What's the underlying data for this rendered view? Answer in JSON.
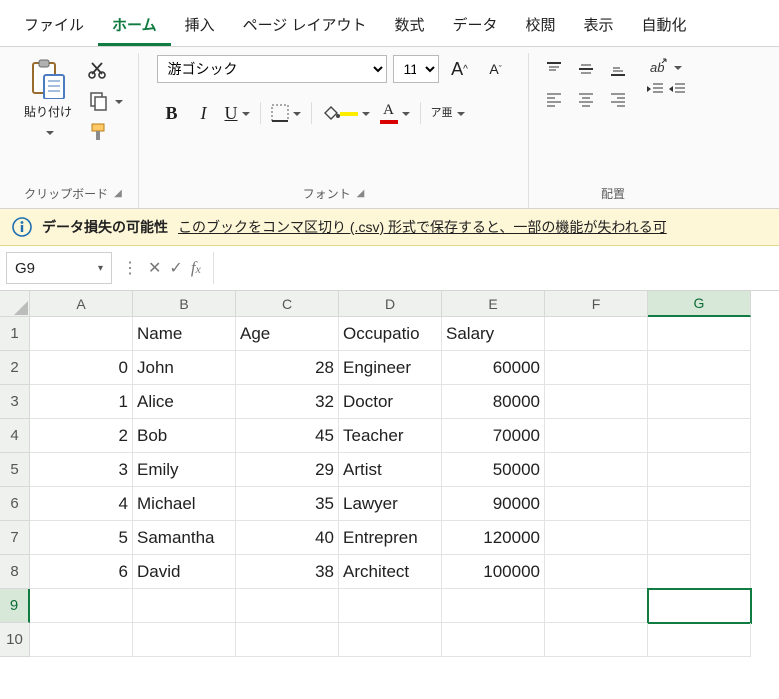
{
  "menu": {
    "items": [
      "ファイル",
      "ホーム",
      "挿入",
      "ページ レイアウト",
      "数式",
      "データ",
      "校閲",
      "表示",
      "自動化"
    ],
    "active_index": 1
  },
  "ribbon": {
    "clipboard": {
      "paste_label": "貼り付け",
      "group_label": "クリップボード"
    },
    "font": {
      "name": "游ゴシック",
      "size": "11",
      "group_label": "フォント",
      "bold": "B",
      "italic": "I",
      "underline": "U",
      "ruby": "ア亜"
    },
    "alignment": {
      "group_label": "配置"
    }
  },
  "warning": {
    "title": "データ損失の可能性",
    "message": "このブックをコンマ区切り (.csv) 形式で保存すると、一部の機能が失われる可"
  },
  "namebox": "G9",
  "formula": "",
  "grid": {
    "cols": [
      "A",
      "B",
      "C",
      "D",
      "E",
      "F",
      "G"
    ],
    "selected": {
      "row": 9,
      "col": 7
    },
    "rows": [
      {
        "n": 1,
        "cells": [
          "",
          "Name",
          "Age",
          "Occupatio",
          "Salary",
          "",
          ""
        ]
      },
      {
        "n": 2,
        "cells": [
          "0",
          "John",
          "28",
          "Engineer",
          "60000",
          "",
          ""
        ]
      },
      {
        "n": 3,
        "cells": [
          "1",
          "Alice",
          "32",
          "Doctor",
          "80000",
          "",
          ""
        ]
      },
      {
        "n": 4,
        "cells": [
          "2",
          "Bob",
          "45",
          "Teacher",
          "70000",
          "",
          ""
        ]
      },
      {
        "n": 5,
        "cells": [
          "3",
          "Emily",
          "29",
          "Artist",
          "50000",
          "",
          ""
        ]
      },
      {
        "n": 6,
        "cells": [
          "4",
          "Michael",
          "35",
          "Lawyer",
          "90000",
          "",
          ""
        ]
      },
      {
        "n": 7,
        "cells": [
          "5",
          "Samantha",
          "40",
          "Entrepren",
          "120000",
          "",
          ""
        ]
      },
      {
        "n": 8,
        "cells": [
          "6",
          "David",
          "38",
          "Architect",
          "100000",
          "",
          ""
        ]
      },
      {
        "n": 9,
        "cells": [
          "",
          "",
          "",
          "",
          "",
          "",
          ""
        ]
      },
      {
        "n": 10,
        "cells": [
          "",
          "",
          "",
          "",
          "",
          "",
          ""
        ]
      }
    ],
    "numeric_cols": [
      0,
      2,
      4
    ]
  },
  "chart_data": {
    "type": "table",
    "columns": [
      "",
      "Name",
      "Age",
      "Occupation",
      "Salary"
    ],
    "rows": [
      [
        0,
        "John",
        28,
        "Engineer",
        60000
      ],
      [
        1,
        "Alice",
        32,
        "Doctor",
        80000
      ],
      [
        2,
        "Bob",
        45,
        "Teacher",
        70000
      ],
      [
        3,
        "Emily",
        29,
        "Artist",
        50000
      ],
      [
        4,
        "Michael",
        35,
        "Lawyer",
        90000
      ],
      [
        5,
        "Samantha",
        40,
        "Entrepreneur",
        120000
      ],
      [
        6,
        "David",
        38,
        "Architect",
        100000
      ]
    ]
  }
}
